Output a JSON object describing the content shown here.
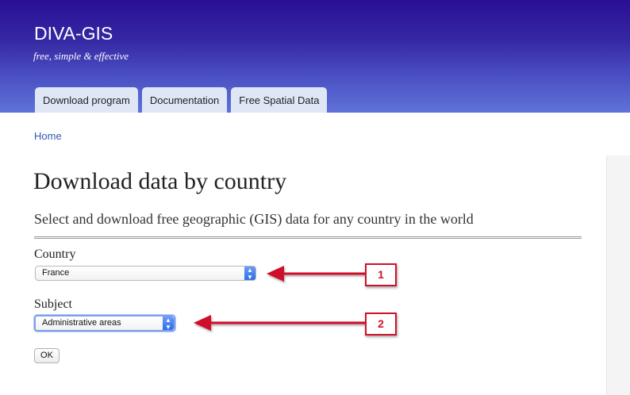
{
  "site": {
    "name": "DIVA-GIS",
    "slogan": "free, simple & effective"
  },
  "tabs": [
    {
      "label": "Download program"
    },
    {
      "label": "Documentation"
    },
    {
      "label": "Free Spatial Data"
    }
  ],
  "breadcrumb": {
    "home": "Home"
  },
  "page": {
    "title": "Download data by country",
    "subtitle": "Select and download free geographic (GIS) data for any country in the world"
  },
  "form": {
    "country_label": "Country",
    "country_value": "France",
    "subject_label": "Subject",
    "subject_value": "Administrative areas",
    "ok_label": "OK"
  },
  "annotations": [
    {
      "number": "1"
    },
    {
      "number": "2"
    }
  ],
  "colors": {
    "header_top": "#2a0f96",
    "header_bottom": "#5f73d8",
    "tab_bg": "#dfe7f7",
    "link": "#3357b5",
    "annotation_red": "#d0112b"
  },
  "icons": {
    "select_arrow": "chevron-up-down-icon"
  }
}
